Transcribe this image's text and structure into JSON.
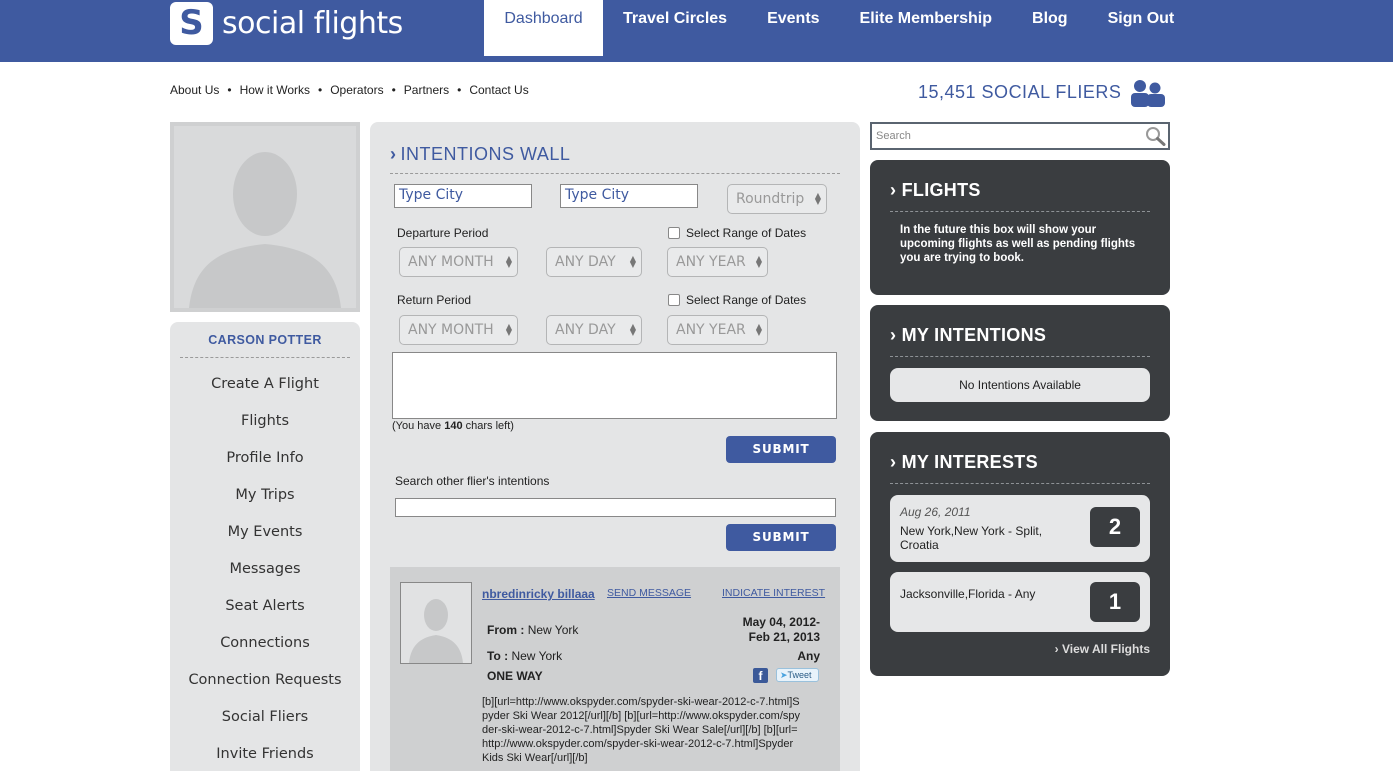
{
  "brand": {
    "logo_letter": "S",
    "name": "social flights"
  },
  "main_nav": [
    "Dashboard",
    "Travel Circles",
    "Events",
    "Elite Membership",
    "Blog",
    "Sign Out"
  ],
  "sub_nav": [
    "About Us",
    "How it Works",
    "Operators",
    "Partners",
    "Contact Us"
  ],
  "fliers": {
    "count_text": "15,451 SOCIAL FLIERS"
  },
  "profile": {
    "name": "CARSON POTTER",
    "links": [
      "Create A Flight",
      "Flights",
      "Profile Info",
      "My Trips",
      "My Events",
      "Messages",
      "Seat Alerts",
      "Connections",
      "Connection Requests",
      "Social Fliers",
      "Invite Friends"
    ]
  },
  "wall": {
    "title": "INTENTIONS WALL",
    "from_city_placeholder": "Type City",
    "to_city_placeholder": "Type City",
    "trip_type": "Roundtrip",
    "departure_label": "Departure Period",
    "return_label": "Return Period",
    "range_label": "Select Range of Dates",
    "month": "ANY MONTH",
    "day": "ANY DAY",
    "year": "ANY YEAR",
    "chars_prefix": "(You have ",
    "chars_count": "140",
    "chars_suffix": " chars left)",
    "submit": "SUBMIT",
    "search_label": "Search other flier's intentions",
    "search_submit": "SUBMIT"
  },
  "post": {
    "user": "nbredinricky billaaa",
    "send_message": "SEND MESSAGE",
    "indicate_interest": "INDICATE INTEREST",
    "from_label": "From :",
    "from_city": "New York",
    "to_label": "To :",
    "to_city": "New York",
    "date_line1": "May 04, 2012-",
    "date_line2": "Feb 21, 2013",
    "any": "Any",
    "trip": "ONE WAY",
    "fb": "f",
    "tweet": "Tweet",
    "body": "[b][url=http://www.okspyder.com/spyder-ski-wear-2012-c-7.html]Spyder Ski Wear 2012[/url][/b] [b][url=http://www.okspyder.com/spyder-ski-wear-2012-c-7.html]Spyder Ski Wear Sale[/url][/b] [b][url=http://www.okspyder.com/spyder-ski-wear-2012-c-7.html]Spyder Kids Ski Wear[/url][/b]"
  },
  "search": {
    "placeholder": "Search"
  },
  "flights_panel": {
    "title": "FLIGHTS",
    "text": "In the future this box will show your upcoming flights as well as pending flights you are trying to book."
  },
  "intentions_panel": {
    "title": "MY INTENTIONS",
    "empty": "No Intentions Available"
  },
  "interests_panel": {
    "title": "MY INTERESTS",
    "items": [
      {
        "date": "Aug 26, 2011",
        "route": "New York,New York - Split, Croatia",
        "count": "2"
      },
      {
        "date": "",
        "route": "Jacksonville,Florida - Any",
        "count": "1"
      }
    ],
    "view_all": "› View All Flights"
  },
  "colors": {
    "brand_blue": "#3f5aa0",
    "dark_panel": "#3a3d40",
    "light_panel": "#e4e5e6"
  }
}
